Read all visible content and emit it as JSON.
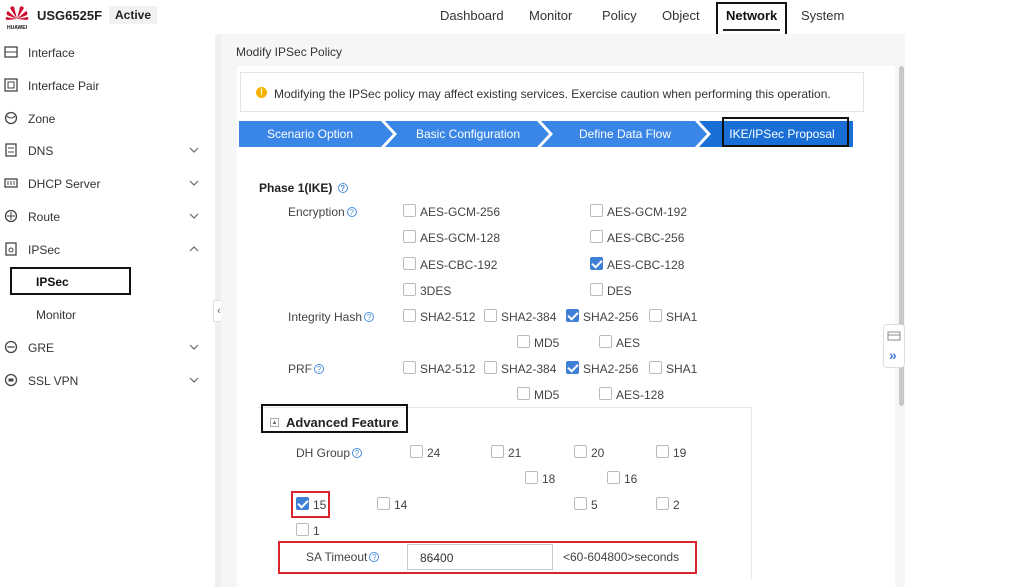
{
  "brand": {
    "vendor": "HUAWEI",
    "model": "USG6525F",
    "status": "Active"
  },
  "nav": [
    "Dashboard",
    "Monitor",
    "Policy",
    "Object",
    "Network",
    "System"
  ],
  "active_nav": "Network",
  "sidebar": {
    "items": [
      {
        "label": "Interface",
        "icon": "interface-icon",
        "chevron": ""
      },
      {
        "label": "Interface Pair",
        "icon": "interface-pair-icon",
        "chevron": ""
      },
      {
        "label": "Zone",
        "icon": "zone-icon",
        "chevron": ""
      },
      {
        "label": "DNS",
        "icon": "dns-icon",
        "chevron": "down"
      },
      {
        "label": "DHCP Server",
        "icon": "dhcp-icon",
        "chevron": "down"
      },
      {
        "label": "Route",
        "icon": "route-icon",
        "chevron": "down"
      },
      {
        "label": "IPSec",
        "icon": "ipsec-icon",
        "chevron": "up"
      },
      {
        "label": "GRE",
        "icon": "gre-icon",
        "chevron": "down"
      },
      {
        "label": "SSL VPN",
        "icon": "sslvpn-icon",
        "chevron": "down"
      }
    ],
    "subitems": [
      "IPSec",
      "Monitor"
    ],
    "selected_sub": "IPSec",
    "collapse_glyph": "‹"
  },
  "page": {
    "title": "Modify IPSec Policy",
    "notice": "Modifying the IPSec policy may affect existing services. Exercise caution when performing this operation.",
    "notice_icon": "!"
  },
  "steps": [
    "Scenario Option",
    "Basic Configuration",
    "Define Data Flow",
    "IKE/IPSec Proposal"
  ],
  "current_step": "IKE/IPSec Proposal",
  "phase1": {
    "title": "Phase 1(IKE)",
    "help": "?",
    "encryption": {
      "label": "Encryption",
      "options": [
        {
          "label": "AES-GCM-256",
          "checked": false
        },
        {
          "label": "AES-GCM-192",
          "checked": false
        },
        {
          "label": "AES-GCM-128",
          "checked": false
        },
        {
          "label": "AES-CBC-256",
          "checked": false
        },
        {
          "label": "AES-CBC-192",
          "checked": false
        },
        {
          "label": "AES-CBC-128",
          "checked": true
        },
        {
          "label": "3DES",
          "checked": false
        },
        {
          "label": "DES",
          "checked": false
        }
      ]
    },
    "integrity": {
      "label": "Integrity Hash",
      "options": [
        {
          "label": "SHA2-512",
          "checked": false
        },
        {
          "label": "SHA2-384",
          "checked": false
        },
        {
          "label": "SHA2-256",
          "checked": true
        },
        {
          "label": "SHA1",
          "checked": false
        },
        {
          "label": "MD5",
          "checked": false
        },
        {
          "label": "AES",
          "checked": false
        }
      ]
    },
    "prf": {
      "label": "PRF",
      "options": [
        {
          "label": "SHA2-512",
          "checked": false
        },
        {
          "label": "SHA2-384",
          "checked": false
        },
        {
          "label": "SHA2-256",
          "checked": true
        },
        {
          "label": "SHA1",
          "checked": false
        },
        {
          "label": "MD5",
          "checked": false
        },
        {
          "label": "AES-128",
          "checked": false
        }
      ]
    }
  },
  "advanced": {
    "title": "Advanced Feature",
    "toggle": "▲",
    "dh_label": "DH Group",
    "dh_options": [
      {
        "label": "24",
        "checked": false
      },
      {
        "label": "21",
        "checked": false
      },
      {
        "label": "20",
        "checked": false
      },
      {
        "label": "19",
        "checked": false
      },
      {
        "label": "18",
        "checked": false
      },
      {
        "label": "16",
        "checked": false
      },
      {
        "label": "15",
        "checked": true
      },
      {
        "label": "14",
        "checked": false
      },
      {
        "label": "5",
        "checked": false
      },
      {
        "label": "2",
        "checked": false
      },
      {
        "label": "1",
        "checked": false
      }
    ],
    "sa_timeout_label": "SA Timeout",
    "sa_timeout_value": "86400",
    "sa_timeout_hint": "<60-604800>seconds"
  },
  "float_glyph": "»",
  "colors": {
    "step_active": "#1a6fd6",
    "step": "#3a86e6",
    "accent": "#3f7fd6",
    "highlight": "#d9262e"
  }
}
